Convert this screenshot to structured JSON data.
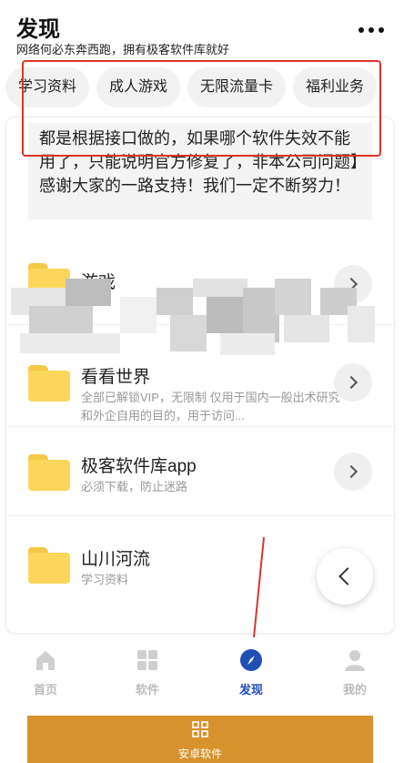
{
  "header": {
    "title": "发现",
    "subtitle": "网络何必东奔西跑，拥有极客软件库就好"
  },
  "chips": [
    "学习资料",
    "成人游戏",
    "无限流量卡",
    "福利业务"
  ],
  "notice": "都是根据接口做的，如果哪个软件失效不能用了，只能说明官方修复了，非本公司问题】感谢大家的一路支持！我们一定不断努力！",
  "rows": [
    {
      "title": "游戏",
      "desc": ""
    },
    {
      "title": "看看世界",
      "desc": "全部已解锁VIP，无限制 仅用于国内一般出术研究和外企自用的目的，用于访问..."
    },
    {
      "title": "极客软件库app",
      "desc": "必须下载，防止迷路"
    },
    {
      "title": "山川河流",
      "desc": "学习资料"
    }
  ],
  "tabbar": {
    "home": "首页",
    "software": "软件",
    "discover": "发现",
    "mine": "我的"
  },
  "banner": {
    "label": "安卓软件"
  },
  "colors": {
    "accent": "#1f4fb3",
    "folder": "#fbd65a",
    "annotation": "#d9352b",
    "banner": "#d8922d"
  },
  "icons": [
    "more-icon",
    "folder-icon",
    "chevron-right-icon",
    "chevron-left-icon",
    "home-icon",
    "grid-icon",
    "compass-icon",
    "person-icon"
  ]
}
